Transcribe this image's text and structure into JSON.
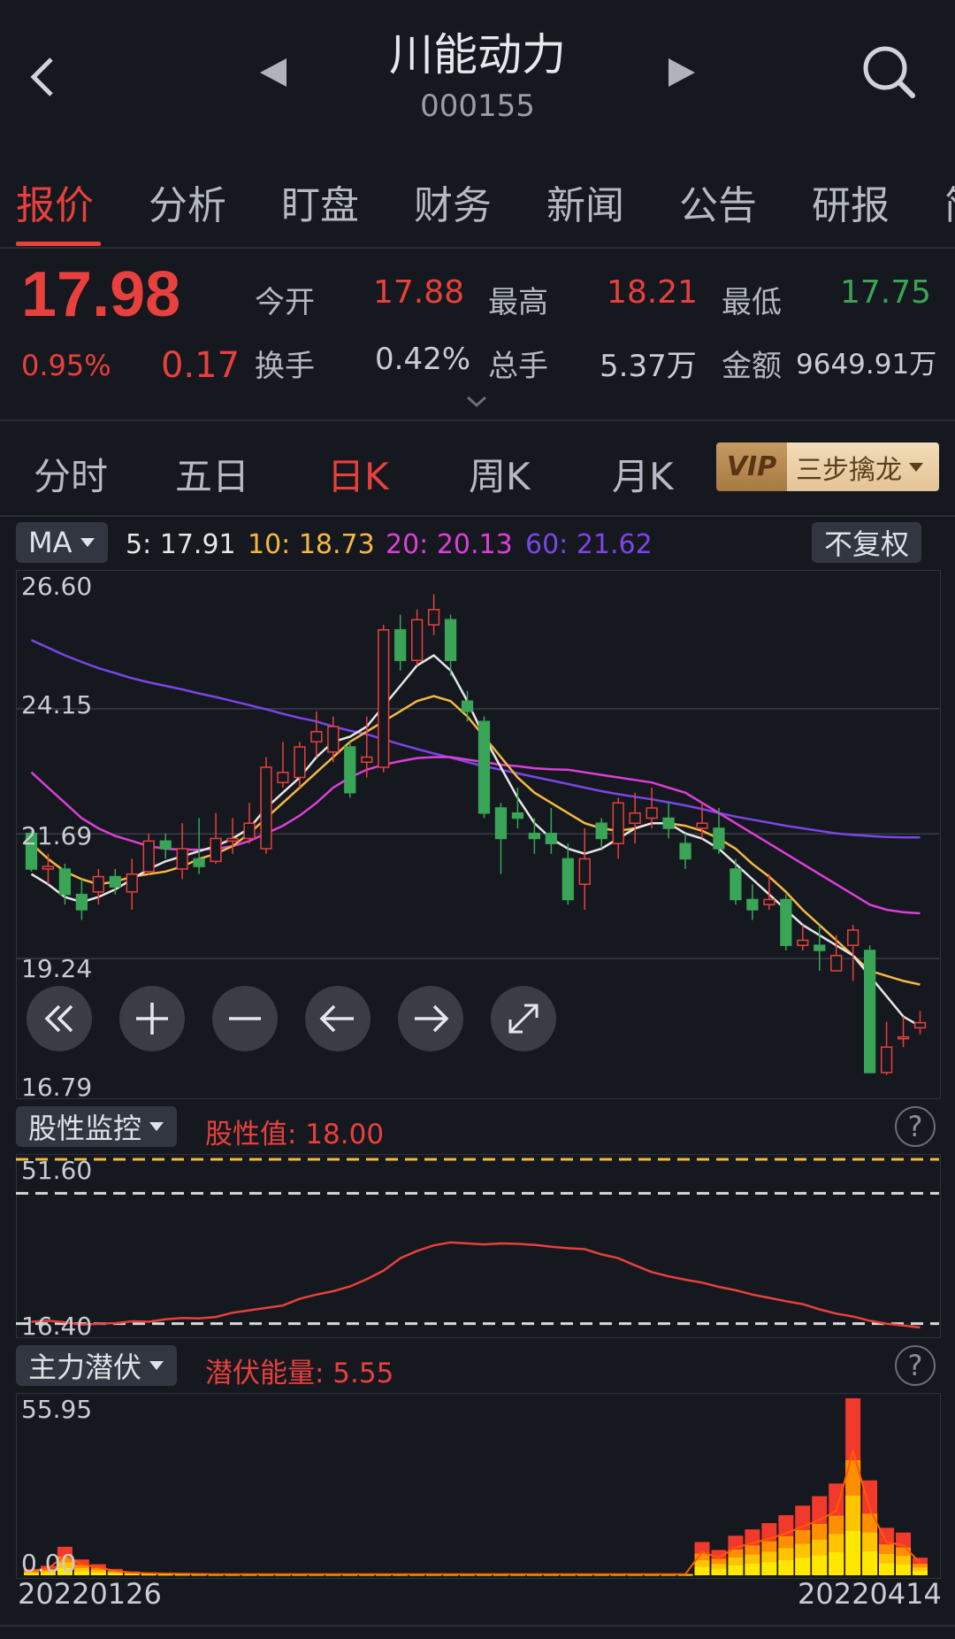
{
  "header": {
    "title": "川能动力",
    "code": "000155"
  },
  "tabs": [
    "报价",
    "分析",
    "盯盘",
    "财务",
    "新闻",
    "公告",
    "研报",
    "简"
  ],
  "quote": {
    "price": "17.98",
    "change_pct": "0.95%",
    "change": "0.17",
    "open_label": "今开",
    "open": "17.88",
    "high_label": "最高",
    "high": "18.21",
    "low_label": "最低",
    "low": "17.75",
    "turnover_label": "换手",
    "turnover": "0.42%",
    "volume_label": "总手",
    "volume": "5.37万",
    "amount_label": "金额",
    "amount": "9649.91万"
  },
  "periods": [
    "分时",
    "五日",
    "日K",
    "周K",
    "月K"
  ],
  "vip": {
    "badge": "VIP",
    "label": "三步擒龙"
  },
  "ma_bar": {
    "selector": "MA",
    "ma5": "5: 17.91",
    "ma10": "10: 18.73",
    "ma20": "20: 20.13",
    "ma60": "60: 21.62",
    "adjust": "不复权"
  },
  "colors": {
    "up": "#e8403d",
    "down": "#3aa556",
    "ma5": "#e6e6e6",
    "ma10": "#f5b942",
    "ma20": "#dd3fd9",
    "ma60": "#7b46e8"
  },
  "chart_data": [
    {
      "type": "candlestick",
      "title": "",
      "ylim": [
        16.79,
        26.6
      ],
      "yticks": [
        "26.60",
        "24.15",
        "21.69",
        "19.24",
        "16.79"
      ],
      "x_start": "20220126",
      "x_end": "20220414",
      "candles": [
        [
          21.7,
          21.0,
          21.75,
          20.95
        ],
        [
          21.0,
          21.05,
          21.3,
          20.7
        ],
        [
          21.0,
          20.5,
          21.1,
          20.3
        ],
        [
          20.5,
          20.2,
          20.8,
          20.0
        ],
        [
          20.55,
          20.85,
          21.0,
          20.3
        ],
        [
          20.85,
          20.65,
          21.0,
          20.5
        ],
        [
          20.55,
          20.9,
          21.2,
          20.2
        ],
        [
          20.95,
          21.55,
          21.7,
          20.9
        ],
        [
          21.55,
          21.4,
          21.7,
          21.2
        ],
        [
          21.0,
          21.4,
          21.9,
          20.8
        ],
        [
          21.2,
          21.05,
          22.0,
          20.9
        ],
        [
          21.15,
          21.6,
          22.1,
          21.1
        ],
        [
          21.55,
          21.6,
          22.0,
          21.3
        ],
        [
          21.6,
          21.9,
          22.3,
          21.5
        ],
        [
          21.4,
          23.0,
          23.2,
          21.3
        ],
        [
          22.7,
          22.9,
          23.5,
          22.6
        ],
        [
          22.8,
          23.4,
          23.5,
          22.6
        ],
        [
          23.5,
          23.7,
          24.1,
          23.2
        ],
        [
          23.3,
          23.8,
          24.0,
          23.1
        ],
        [
          23.4,
          22.5,
          23.5,
          22.4
        ],
        [
          23.1,
          23.2,
          24.0,
          22.8
        ],
        [
          23.0,
          25.7,
          25.8,
          22.9
        ],
        [
          25.7,
          25.1,
          26.0,
          24.9
        ],
        [
          25.1,
          25.9,
          26.1,
          25.0
        ],
        [
          25.8,
          26.1,
          26.4,
          25.6
        ],
        [
          25.9,
          25.1,
          26.0,
          24.8
        ],
        [
          24.3,
          24.1,
          24.5,
          23.9
        ],
        [
          23.9,
          22.1,
          24.0,
          22.0
        ],
        [
          22.2,
          21.6,
          22.3,
          20.9
        ],
        [
          22.1,
          22.0,
          22.6,
          21.8
        ],
        [
          21.7,
          21.6,
          22.0,
          21.3
        ],
        [
          21.7,
          21.5,
          22.2,
          21.3
        ],
        [
          21.2,
          20.4,
          21.5,
          20.3
        ],
        [
          20.7,
          21.2,
          21.8,
          20.2
        ],
        [
          21.9,
          21.6,
          22.0,
          21.4
        ],
        [
          21.5,
          22.3,
          22.4,
          21.2
        ],
        [
          21.9,
          22.1,
          22.5,
          21.5
        ],
        [
          22.0,
          22.2,
          22.6,
          21.8
        ],
        [
          22.0,
          21.8,
          22.3,
          21.6
        ],
        [
          21.5,
          21.2,
          21.7,
          21.0
        ],
        [
          21.8,
          21.9,
          22.3,
          21.6
        ],
        [
          21.8,
          21.4,
          22.2,
          21.3
        ],
        [
          21.0,
          20.4,
          21.2,
          20.3
        ],
        [
          20.4,
          20.2,
          20.7,
          20.0
        ],
        [
          20.3,
          20.4,
          20.9,
          20.2
        ],
        [
          20.4,
          19.5,
          20.5,
          19.4
        ],
        [
          19.5,
          19.6,
          19.9,
          19.4
        ],
        [
          19.5,
          19.4,
          19.9,
          19.0
        ],
        [
          19.0,
          19.3,
          19.7,
          19.0
        ],
        [
          19.5,
          19.8,
          19.9,
          18.8
        ],
        [
          19.4,
          17.0,
          19.5,
          17.0
        ],
        [
          17.0,
          17.5,
          18.0,
          16.95
        ],
        [
          17.7,
          17.7,
          18.1,
          17.5
        ],
        [
          17.88,
          17.98,
          18.21,
          17.75
        ]
      ],
      "ma5": [
        20.9,
        20.7,
        20.45,
        20.35,
        20.45,
        20.6,
        20.8,
        21.0,
        21.15,
        21.25,
        21.35,
        21.45,
        21.6,
        21.8,
        22.2,
        22.5,
        22.8,
        23.2,
        23.5,
        23.6,
        23.8,
        24.2,
        24.6,
        25.0,
        25.2,
        24.9,
        24.3,
        23.6,
        23.0,
        22.4,
        21.9,
        21.6,
        21.4,
        21.3,
        21.4,
        21.6,
        21.8,
        21.9,
        21.9,
        21.7,
        21.6,
        21.4,
        21.1,
        20.8,
        20.5,
        20.2,
        19.9,
        19.7,
        19.5,
        19.3,
        18.9,
        18.5,
        18.1,
        17.91
      ],
      "ma10": [
        21.5,
        21.2,
        20.95,
        20.8,
        20.7,
        20.75,
        20.85,
        20.9,
        20.95,
        21.05,
        21.2,
        21.3,
        21.45,
        21.7,
        22.0,
        22.3,
        22.6,
        22.9,
        23.2,
        23.5,
        23.7,
        23.9,
        24.1,
        24.3,
        24.4,
        24.3,
        24.0,
        23.6,
        23.2,
        22.8,
        22.5,
        22.3,
        22.1,
        21.9,
        21.8,
        21.75,
        21.8,
        21.9,
        21.9,
        21.85,
        21.75,
        21.6,
        21.4,
        21.1,
        20.85,
        20.55,
        20.2,
        19.9,
        19.6,
        19.3,
        19.0,
        18.9,
        18.8,
        18.73
      ],
      "ma20": [
        22.9,
        22.6,
        22.3,
        22.0,
        21.8,
        21.65,
        21.55,
        21.45,
        21.4,
        21.38,
        21.38,
        21.4,
        21.45,
        21.55,
        21.7,
        21.85,
        22.05,
        22.3,
        22.6,
        22.8,
        22.95,
        23.05,
        23.12,
        23.18,
        23.2,
        23.2,
        23.15,
        23.1,
        23.05,
        23.02,
        22.98,
        22.96,
        22.95,
        22.9,
        22.85,
        22.8,
        22.75,
        22.7,
        22.6,
        22.5,
        22.3,
        22.1,
        21.9,
        21.7,
        21.5,
        21.3,
        21.1,
        20.9,
        20.7,
        20.5,
        20.3,
        20.2,
        20.15,
        20.13
      ],
      "ma60": [
        25.5,
        25.35,
        25.2,
        25.07,
        24.95,
        24.85,
        24.75,
        24.67,
        24.6,
        24.53,
        24.45,
        24.38,
        24.3,
        24.22,
        24.14,
        24.05,
        23.97,
        23.9,
        23.8,
        23.72,
        23.65,
        23.55,
        23.45,
        23.36,
        23.27,
        23.19,
        23.1,
        23.02,
        22.95,
        22.88,
        22.81,
        22.74,
        22.67,
        22.6,
        22.53,
        22.47,
        22.42,
        22.37,
        22.31,
        22.25,
        22.18,
        22.1,
        22.03,
        21.97,
        21.91,
        21.85,
        21.8,
        21.75,
        21.7,
        21.67,
        21.65,
        21.63,
        21.62,
        21.62
      ]
    },
    {
      "type": "line",
      "title": "",
      "selector": "股性监控",
      "value_label": "股性值: 18.00",
      "yticks": [
        "51.60",
        "16.40"
      ],
      "ylim": [
        16.4,
        51.6
      ],
      "x": [
        "20220126",
        "20220414"
      ],
      "values": [
        17.6,
        17.8,
        17.5,
        17.0,
        17.2,
        17.3,
        17.7,
        17.6,
        18.1,
        18.4,
        18.3,
        18.6,
        19.5,
        20.0,
        20.5,
        21.0,
        22.4,
        23.3,
        24.0,
        25.0,
        26.5,
        28.3,
        30.9,
        32.4,
        33.6,
        34.2,
        34.0,
        33.8,
        34.0,
        33.9,
        33.7,
        33.3,
        33.0,
        32.8,
        31.7,
        30.9,
        29.4,
        28.0,
        27.1,
        26.4,
        25.8,
        24.9,
        24.2,
        23.3,
        22.6,
        21.9,
        21.3,
        20.2,
        19.3,
        18.7,
        17.8,
        17.2,
        16.8,
        16.4
      ]
    },
    {
      "type": "bar",
      "title": "",
      "selector": "主力潜伏",
      "value_label": "潜伏能量: 5.55",
      "yticks": [
        "55.95",
        "0.00"
      ],
      "ylim": [
        0,
        55.95
      ],
      "x": [
        "20220126",
        "20220414"
      ],
      "values": [
        2.0,
        3.0,
        9.0,
        5.0,
        3.5,
        2.0,
        1.2,
        0.9,
        0.8,
        0.7,
        0.6,
        0.5,
        0.5,
        0.5,
        0.5,
        0.5,
        0.5,
        0.5,
        0.5,
        0.5,
        0.5,
        0.5,
        0.5,
        0.5,
        0.5,
        0.5,
        0.5,
        0.5,
        0.5,
        0.5,
        0.5,
        0.5,
        0.5,
        0.5,
        0.5,
        0.5,
        0.5,
        0.5,
        0.5,
        0.5,
        10.5,
        8.0,
        12.5,
        14.5,
        16.5,
        19.0,
        22.0,
        25.0,
        29.0,
        55.95,
        30.0,
        15.0,
        13.5,
        5.55
      ]
    }
  ],
  "controls": {
    "chart_buttons": [
      "rewind-icon",
      "zoom-in-icon",
      "zoom-out-icon",
      "arrow-left-icon",
      "arrow-right-icon",
      "fullscreen-icon"
    ]
  }
}
